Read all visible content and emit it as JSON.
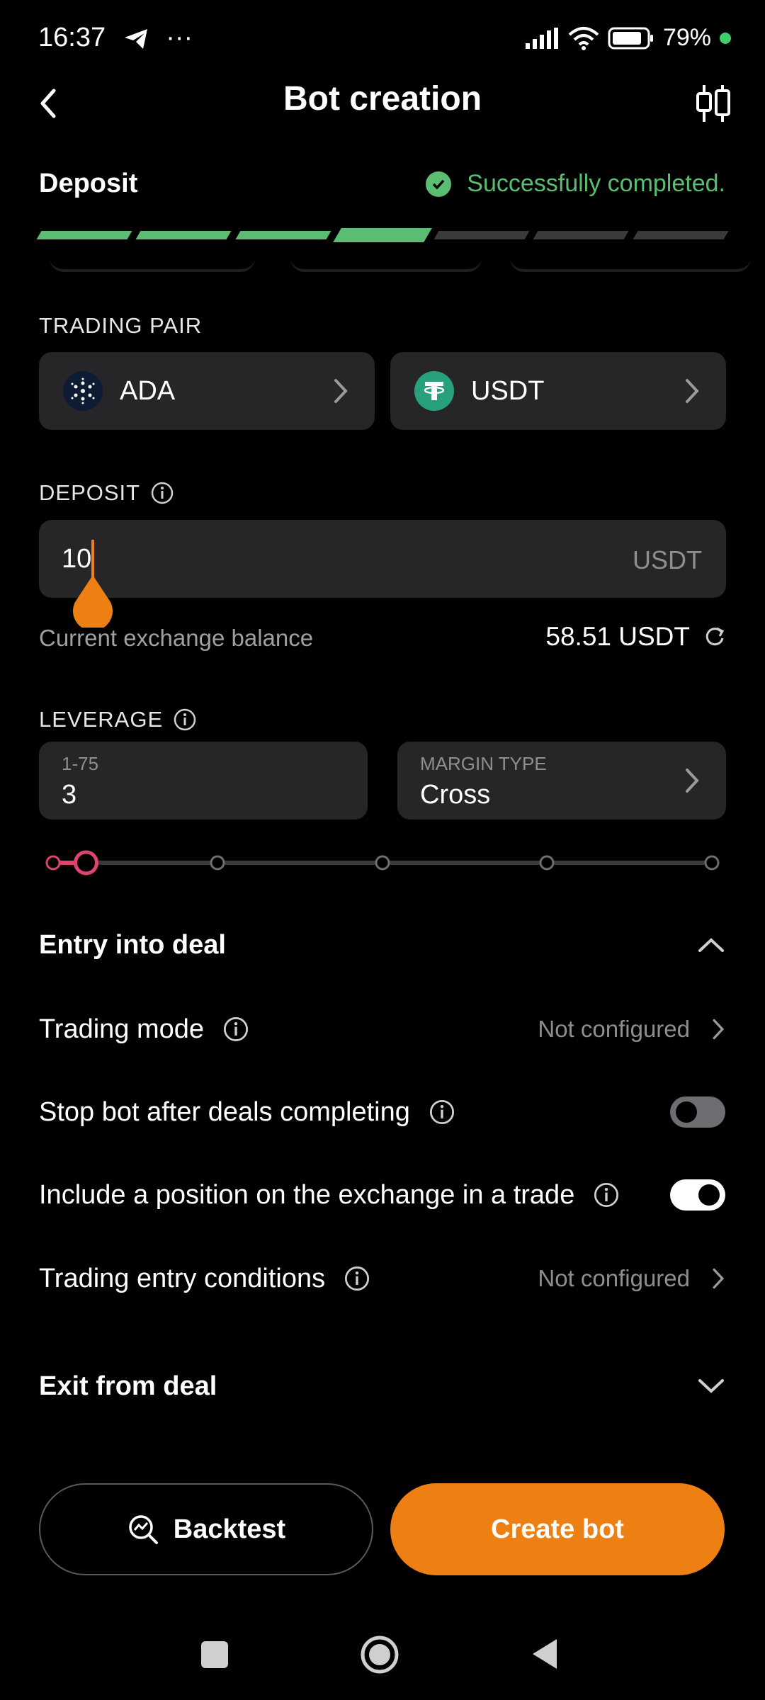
{
  "status_bar": {
    "time": "16:37",
    "dots": "···",
    "battery": "79%"
  },
  "header": {
    "title": "Bot creation"
  },
  "step": {
    "title": "Deposit",
    "status": "Successfully completed.",
    "total_steps": 7,
    "completed_steps": 4
  },
  "trading_pair": {
    "label": "TRADING PAIR",
    "base": "ADA",
    "quote": "USDT"
  },
  "deposit": {
    "label": "DEPOSIT",
    "value": "10",
    "currency": "USDT",
    "balance_label": "Current exchange balance",
    "balance_value": "58.51 USDT"
  },
  "leverage": {
    "label": "LEVERAGE",
    "range_label": "1-75",
    "value": "3",
    "margin_label": "MARGIN TYPE",
    "margin_value": "Cross",
    "slider_fraction": 0.05
  },
  "entry": {
    "title": "Entry into deal",
    "trading_mode_label": "Trading mode",
    "trading_mode_value": "Not configured",
    "stop_bot_label": "Stop bot after deals completing",
    "stop_bot_on": false,
    "include_position_label": "Include a position on the exchange in a trade",
    "include_position_on": true,
    "entry_conditions_label": "Trading entry conditions",
    "entry_conditions_value": "Not configured"
  },
  "exit": {
    "title": "Exit from deal"
  },
  "actions": {
    "backtest": "Backtest",
    "create": "Create bot"
  },
  "colors": {
    "accent": "#ee7f12",
    "success": "#5bbd72",
    "card": "#262628",
    "leverage": "#e0436d"
  }
}
